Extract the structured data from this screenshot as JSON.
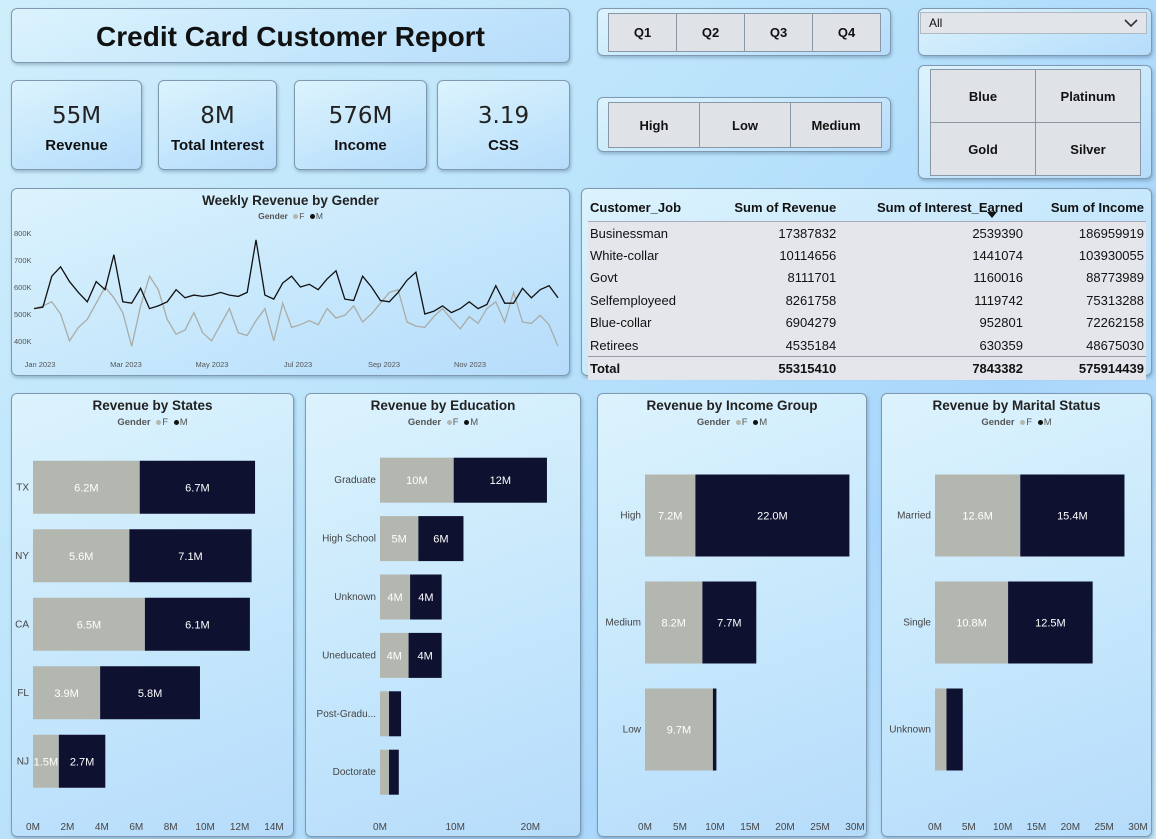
{
  "report_title": "Credit Card Customer Report",
  "kpis": [
    {
      "value": "55M",
      "label": "Revenue"
    },
    {
      "value": "8M",
      "label": "Total Interest"
    },
    {
      "value": "576M",
      "label": "Income"
    },
    {
      "value": "3.19",
      "label": "CSS"
    }
  ],
  "quarter_buttons": [
    "Q1",
    "Q2",
    "Q3",
    "Q4"
  ],
  "income_buttons": [
    "High",
    "Low",
    "Medium"
  ],
  "dropdown": {
    "selected": "All",
    "icon": "chevron-down-icon"
  },
  "card_buttons": [
    "Blue",
    "Platinum",
    "Gold",
    "Silver"
  ],
  "colors": {
    "female": "#b4b7b0",
    "male": "#0e1130",
    "line_female": "#a9aca6",
    "line_male": "#111111"
  },
  "legend": {
    "title": "Gender",
    "f": "F",
    "m": "M"
  },
  "job_table": {
    "columns": [
      "Customer_Job",
      "Sum of Revenue",
      "Sum of Interest_Earned",
      "Sum of Income"
    ],
    "rows": [
      [
        "Businessman",
        "17387832",
        "2539390",
        "186959919"
      ],
      [
        "White-collar",
        "10114656",
        "1441074",
        "103930055"
      ],
      [
        "Govt",
        "8111701",
        "1160016",
        "88773989"
      ],
      [
        "Selfemployeed",
        "8261758",
        "1119742",
        "75313288"
      ],
      [
        "Blue-collar",
        "6904279",
        "952801",
        "72262158"
      ],
      [
        "Retirees",
        "4535184",
        "630359",
        "48675030"
      ]
    ],
    "total": [
      "Total",
      "55315410",
      "7843382",
      "575914439"
    ]
  },
  "chart_data": [
    {
      "id": "weekly",
      "type": "line",
      "title": "Weekly Revenue by Gender",
      "x_tick_labels": [
        "Jan 2023",
        "Mar 2023",
        "May 2023",
        "Jul 2023",
        "Sep 2023",
        "Nov 2023"
      ],
      "y_tick_labels": [
        "400K",
        "500K",
        "600K",
        "700K",
        "800K"
      ],
      "ylim": [
        370000,
        830000
      ],
      "series": [
        {
          "name": "M",
          "values": [
            520000,
            525000,
            640000,
            675000,
            620000,
            580000,
            545000,
            620000,
            590000,
            720000,
            545000,
            540000,
            595000,
            520000,
            530000,
            545000,
            590000,
            560000,
            570000,
            565000,
            570000,
            580000,
            570000,
            565000,
            580000,
            775000,
            570000,
            555000,
            615000,
            640000,
            600000,
            610000,
            590000,
            630000,
            660000,
            555000,
            550000,
            640000,
            600000,
            550000,
            545000,
            580000,
            625000,
            655000,
            500000,
            510000,
            530000,
            505000,
            520000,
            545000,
            520000,
            535000,
            605000,
            540000,
            540000,
            595000,
            560000,
            590000,
            605000,
            560000
          ]
        },
        {
          "name": "F",
          "values": [
            520000,
            530000,
            545000,
            500000,
            400000,
            450000,
            480000,
            540000,
            600000,
            560000,
            505000,
            380000,
            530000,
            640000,
            590000,
            480000,
            425000,
            440000,
            505000,
            430000,
            400000,
            460000,
            520000,
            430000,
            420000,
            475000,
            520000,
            400000,
            540000,
            450000,
            460000,
            475000,
            460000,
            520000,
            485000,
            495000,
            530000,
            470000,
            500000,
            540000,
            580000,
            590000,
            470000,
            455000,
            450000,
            490000,
            520000,
            480000,
            445000,
            490000,
            465000,
            520000,
            545000,
            470000,
            580000,
            470000,
            465000,
            495000,
            460000,
            380000
          ]
        }
      ]
    },
    {
      "id": "states",
      "type": "bar",
      "title": "Revenue by States",
      "categories": [
        "TX",
        "NY",
        "CA",
        "FL",
        "NJ"
      ],
      "series": [
        {
          "name": "F",
          "values": [
            6.2,
            5.6,
            6.5,
            3.9,
            1.5
          ],
          "labels": [
            "6.2M",
            "5.6M",
            "6.5M",
            "3.9M",
            "1.5M"
          ]
        },
        {
          "name": "M",
          "values": [
            6.7,
            7.1,
            6.1,
            5.8,
            2.7
          ],
          "labels": [
            "6.7M",
            "7.1M",
            "6.1M",
            "5.8M",
            "2.7M"
          ]
        }
      ],
      "xlim": [
        0,
        14
      ],
      "x_tick_labels": [
        "0M",
        "2M",
        "4M",
        "6M",
        "8M",
        "10M",
        "12M",
        "14M"
      ]
    },
    {
      "id": "education",
      "type": "bar",
      "title": "Revenue by Education",
      "categories": [
        "Graduate",
        "High School",
        "Unknown",
        "Uneducated",
        "Post-Gradu...",
        "Doctorate"
      ],
      "series": [
        {
          "name": "F",
          "values": [
            9.8,
            5.1,
            4.0,
            3.8,
            1.2,
            1.2
          ],
          "labels": [
            "10M",
            "5M",
            "4M",
            "4M",
            "",
            ""
          ]
        },
        {
          "name": "M",
          "values": [
            12.4,
            6.0,
            4.2,
            4.4,
            1.6,
            1.3
          ],
          "labels": [
            "12M",
            "6M",
            "4M",
            "4M",
            "",
            ""
          ]
        }
      ],
      "xlim": [
        0,
        25
      ],
      "x_tick_labels": [
        "0M",
        "10M",
        "20M"
      ]
    },
    {
      "id": "income_group",
      "type": "bar",
      "title": "Revenue by Income Group",
      "categories": [
        "High",
        "Medium",
        "Low"
      ],
      "series": [
        {
          "name": "F",
          "values": [
            7.2,
            8.2,
            9.7
          ],
          "labels": [
            "7.2M",
            "8.2M",
            "9.7M"
          ]
        },
        {
          "name": "M",
          "values": [
            22.0,
            7.7,
            0.5
          ],
          "labels": [
            "22.0M",
            "7.7M",
            ""
          ]
        }
      ],
      "xlim": [
        0,
        30
      ],
      "x_tick_labels": [
        "0M",
        "5M",
        "10M",
        "15M",
        "20M",
        "25M",
        "30M"
      ]
    },
    {
      "id": "marital",
      "type": "bar",
      "title": "Revenue by Marital Status",
      "categories": [
        "Married",
        "Single",
        "Unknown"
      ],
      "series": [
        {
          "name": "F",
          "values": [
            12.6,
            10.8,
            1.7
          ],
          "labels": [
            "12.6M",
            "10.8M",
            ""
          ]
        },
        {
          "name": "M",
          "values": [
            15.4,
            12.5,
            2.4
          ],
          "labels": [
            "15.4M",
            "12.5M",
            ""
          ]
        }
      ],
      "xlim": [
        0,
        30
      ],
      "x_tick_labels": [
        "0M",
        "5M",
        "10M",
        "15M",
        "20M",
        "25M",
        "30M"
      ]
    }
  ]
}
